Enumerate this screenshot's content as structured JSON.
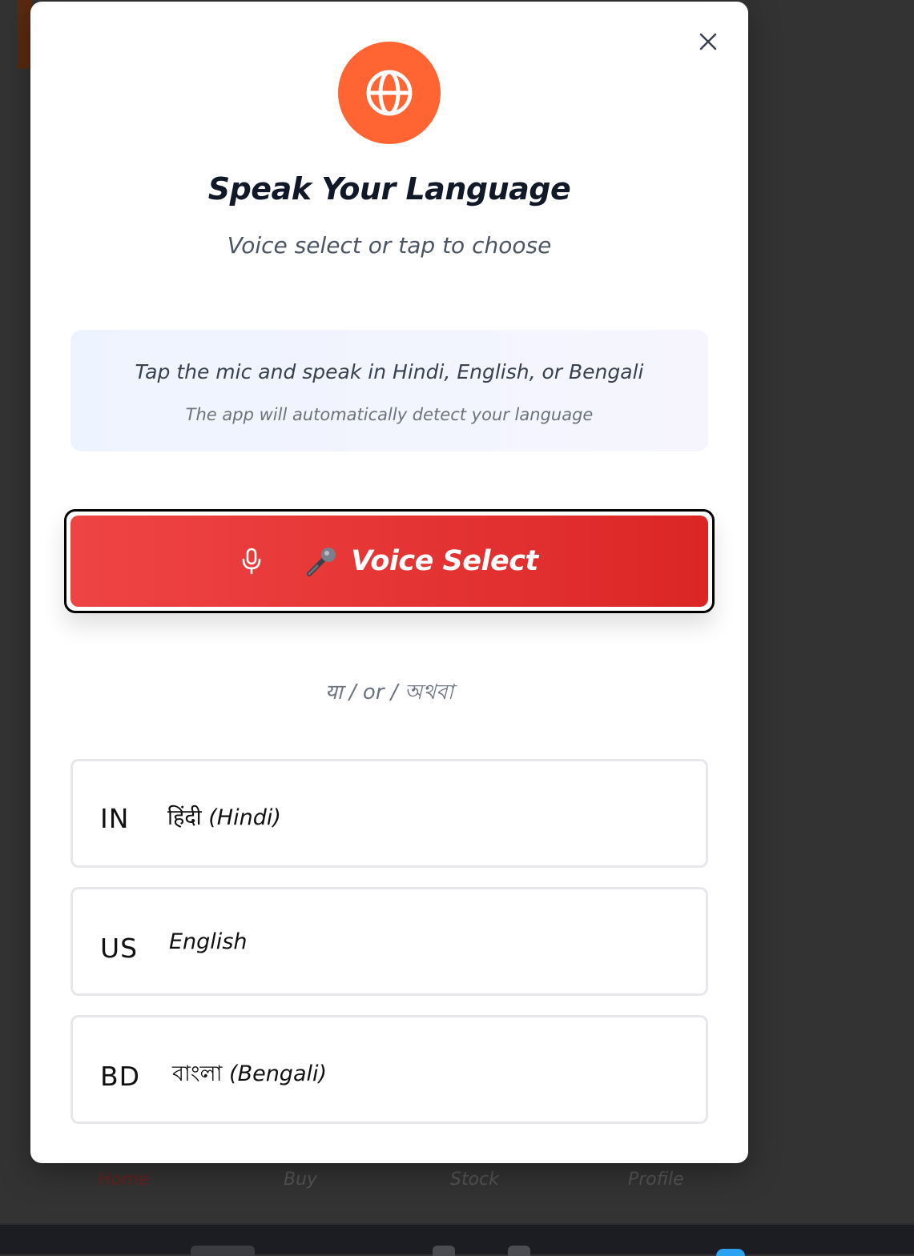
{
  "background": {
    "bottom_nav": [
      {
        "label": "Home"
      },
      {
        "label": "Buy"
      },
      {
        "label": "Stock"
      },
      {
        "label": "Profile"
      }
    ]
  },
  "modal": {
    "close_icon": "close-icon",
    "badge_icon": "globe-icon",
    "title": "Speak Your Language",
    "subtitle": "Voice select or tap to choose",
    "info": {
      "main": "Tap the mic and speak in Hindi, English, or Bengali",
      "sub": "The app will automatically detect your language"
    },
    "voice_button": {
      "icon": "microphone-icon",
      "emoji": "🎤",
      "label": "Voice Select"
    },
    "divider_text": "या / or / অথবা",
    "languages": [
      {
        "code": "IN",
        "native": "हिंदी",
        "english": "(Hindi)"
      },
      {
        "code": "US",
        "native": "",
        "english": "English"
      },
      {
        "code": "BD",
        "native": "বাংলা",
        "english": "(Bengali)"
      }
    ]
  },
  "colors": {
    "accent_orange": "#ff6432",
    "button_red_start": "#ef4444",
    "button_red_end": "#dc2626",
    "backdrop": "#333333"
  }
}
